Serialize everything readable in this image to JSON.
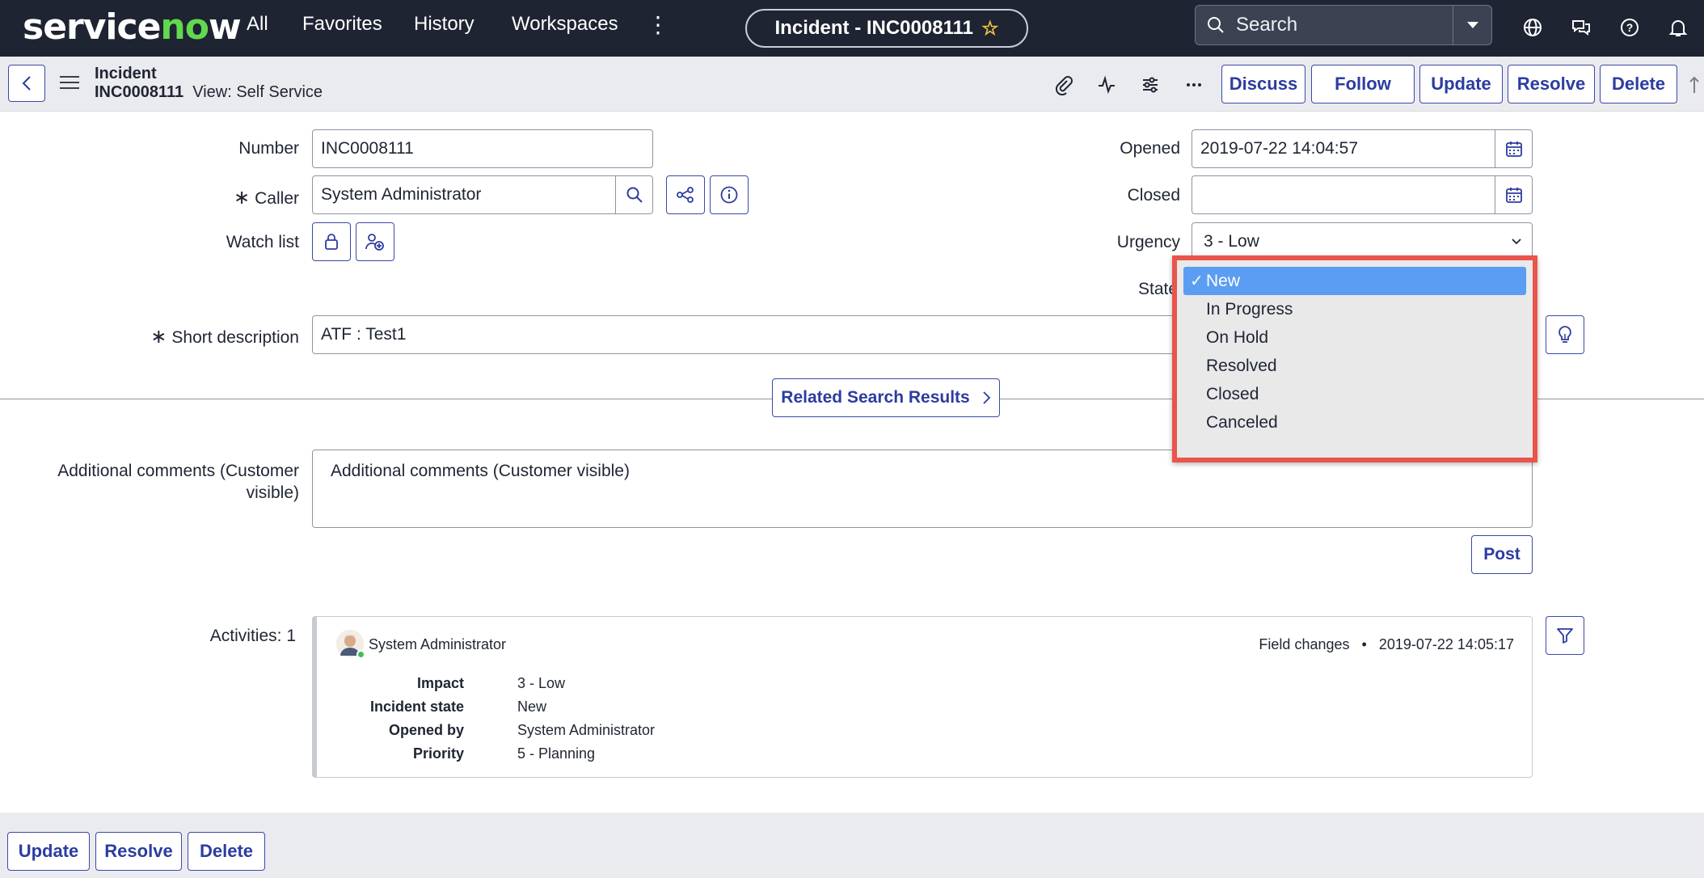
{
  "topnav": {
    "logo_text": "servicenow",
    "links": [
      "All",
      "Favorites",
      "History",
      "Workspaces"
    ],
    "record_pill": "Incident - INC0008111",
    "search_placeholder": "Search"
  },
  "header": {
    "record_type": "Incident",
    "record_number": "INC0008111",
    "view_label": "View: Self Service",
    "buttons": [
      "Discuss",
      "Follow",
      "Update",
      "Resolve",
      "Delete"
    ]
  },
  "form": {
    "number": {
      "label": "Number",
      "value": "INC0008111"
    },
    "caller": {
      "label": "Caller",
      "value": "System Administrator"
    },
    "watch_list": {
      "label": "Watch list"
    },
    "opened": {
      "label": "Opened",
      "value": "2019-07-22 14:04:57"
    },
    "closed": {
      "label": "Closed",
      "value": ""
    },
    "urgency": {
      "label": "Urgency",
      "value": "3 - Low"
    },
    "state": {
      "label": "State"
    },
    "short_description": {
      "label": "Short description",
      "value": "ATF : Test1"
    },
    "related_search": "Related Search Results",
    "additional_comments": {
      "label_line1": "Additional comments (Customer",
      "label_line2": "visible)",
      "placeholder": "Additional comments (Customer visible)"
    },
    "post_button": "Post"
  },
  "state_dropdown": {
    "options": [
      "New",
      "In Progress",
      "On Hold",
      "Resolved",
      "Closed",
      "Canceled"
    ],
    "selected": "New",
    "check": "✓",
    "highlight_color": "#e9544b"
  },
  "activities": {
    "label": "Activities: 1",
    "entry": {
      "user": "System Administrator",
      "type": "Field changes",
      "timestamp": "2019-07-22 14:05:17",
      "fields": [
        {
          "key": "Impact",
          "value": "3 - Low"
        },
        {
          "key": "Incident state",
          "value": "New"
        },
        {
          "key": "Opened by",
          "value": "System Administrator"
        },
        {
          "key": "Priority",
          "value": "5 - Planning"
        }
      ]
    }
  },
  "footer": {
    "buttons": [
      "Update",
      "Resolve",
      "Delete"
    ]
  },
  "colors": {
    "nav_bg": "#1e2432",
    "brand_green": "#62d84e",
    "button_blue": "#2c3ca0",
    "selected_blue": "#5b9df2"
  },
  "icons": [
    "search-icon",
    "globe-icon",
    "chat-icon",
    "help-icon",
    "bell-icon",
    "paperclip-icon",
    "activity-icon",
    "settings-sliders-icon",
    "more-icon",
    "calendar-icon",
    "lock-icon",
    "add-user-icon",
    "hierarchy-icon",
    "info-icon",
    "lightbulb-icon",
    "filter-icon",
    "chevron-right-icon",
    "chevron-down-icon",
    "star-icon",
    "back-icon"
  ]
}
